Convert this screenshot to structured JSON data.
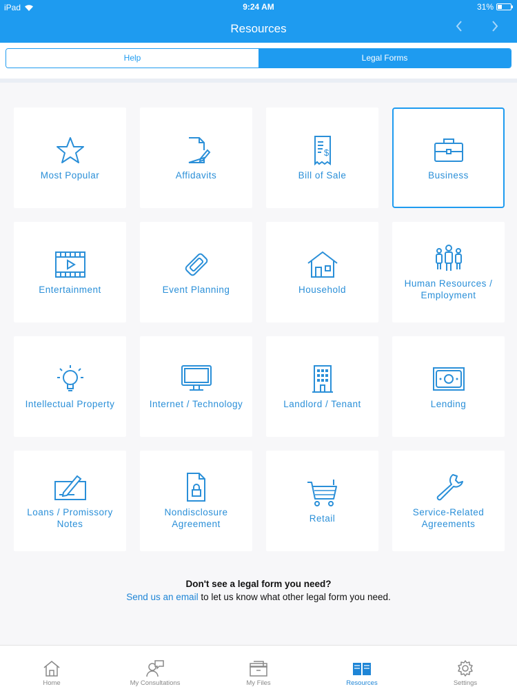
{
  "status": {
    "device": "iPad",
    "time": "9:24 AM",
    "battery": "31%",
    "battery_level": 0.31
  },
  "nav": {
    "title": "Resources",
    "back_icon": "chevron-left-icon",
    "forward_icon": "chevron-right-icon"
  },
  "segments": {
    "help": "Help",
    "legal_forms": "Legal Forms",
    "selected": "legal_forms"
  },
  "tiles": [
    {
      "label": "Most Popular",
      "icon": "star-icon"
    },
    {
      "label": "Affidavits",
      "icon": "document-pen-icon"
    },
    {
      "label": "Bill of Sale",
      "icon": "receipt-icon"
    },
    {
      "label": "Business",
      "icon": "briefcase-icon",
      "selected": true
    },
    {
      "label": "Entertainment",
      "icon": "film-icon"
    },
    {
      "label": "Event Planning",
      "icon": "ticket-icon"
    },
    {
      "label": "Household",
      "icon": "house-icon"
    },
    {
      "label": "Human Resources / Employment",
      "icon": "people-icon"
    },
    {
      "label": "Intellectual Property",
      "icon": "lightbulb-icon"
    },
    {
      "label": "Internet / Technology",
      "icon": "monitor-icon"
    },
    {
      "label": "Landlord / Tenant",
      "icon": "building-icon"
    },
    {
      "label": "Lending",
      "icon": "banknote-icon"
    },
    {
      "label": "Loans / Promissory Notes",
      "icon": "check-pen-icon"
    },
    {
      "label": "Nondisclosure Agreement",
      "icon": "lock-document-icon"
    },
    {
      "label": "Retail",
      "icon": "cart-icon"
    },
    {
      "label": "Service-Related Agreements",
      "icon": "wrench-icon"
    }
  ],
  "footer": {
    "heading": "Don't see a legal form you need?",
    "link": "Send us an email",
    "text": " to let us know what other legal form you need."
  },
  "tabbar": {
    "home": "Home",
    "consultations": "My Consultations",
    "files": "My Files",
    "resources": "Resources",
    "settings": "Settings",
    "active": "resources"
  },
  "colors": {
    "accent": "#1e9bf0",
    "tile_text": "#2a8fd8",
    "background": "#f7f7f9"
  }
}
